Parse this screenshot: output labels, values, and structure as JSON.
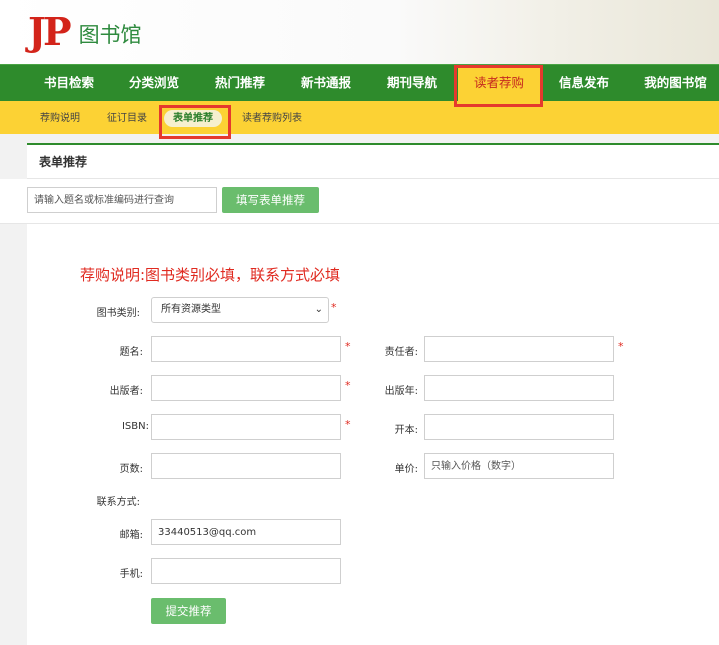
{
  "header": {
    "logo_mark": "JP",
    "logo_text": "图书馆"
  },
  "main_nav": [
    {
      "label": "书目检索"
    },
    {
      "label": "分类浏览"
    },
    {
      "label": "热门推荐"
    },
    {
      "label": "新书通报"
    },
    {
      "label": "期刊导航"
    },
    {
      "label": "读者荐购",
      "active": true
    },
    {
      "label": "信息发布"
    },
    {
      "label": "我的图书馆"
    }
  ],
  "sub_nav": [
    {
      "label": "荐购说明"
    },
    {
      "label": "征订目录"
    },
    {
      "label": "表单推荐",
      "active": true
    },
    {
      "label": "读者荐购列表"
    }
  ],
  "panel": {
    "title": "表单推荐"
  },
  "search": {
    "placeholder": "请输入题名或标准编码进行查询",
    "button_label": "填写表单推荐"
  },
  "notice": "荐购说明:图书类别必填，联系方式必填",
  "form": {
    "category_label": "图书类别:",
    "category_value": "所有资源类型",
    "title_label": "题名:",
    "responsible_label": "责任者:",
    "publisher_label": "出版者:",
    "pub_year_label": "出版年:",
    "isbn_label": "ISBN:",
    "format_label": "开本:",
    "pages_label": "页数:",
    "price_label": "单价:",
    "price_placeholder": "只输入价格（数字）",
    "contact_label": "联系方式:",
    "email_label": "邮箱:",
    "email_value": "33440513@qq.com",
    "phone_label": "手机:",
    "required_mark": "*",
    "submit_label": "提交推荐"
  },
  "colors": {
    "nav_green": "#2e8b2c",
    "sub_yellow": "#fcd234",
    "accent_red": "#e02a20",
    "button_green": "#6abd6d"
  }
}
